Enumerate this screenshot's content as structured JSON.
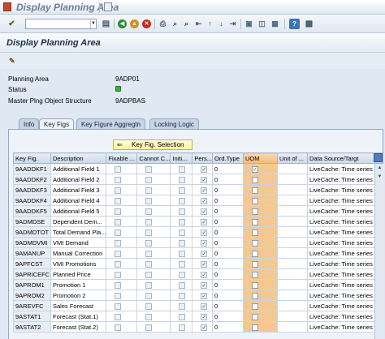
{
  "window": {
    "title": "Display Planning Area"
  },
  "toolbar": {
    "command_value": "",
    "buttons": [
      "enter",
      "save",
      "back",
      "exit",
      "cancel",
      "print",
      "find",
      "find-next",
      "first-page",
      "previous-page",
      "next-page",
      "last-page",
      "create-session",
      "generate-shortcut",
      "help",
      "layout"
    ]
  },
  "screen": {
    "title": "Display Planning Area"
  },
  "fields": {
    "planning_area_label": "Planning Area",
    "planning_area_value": "9ADP01",
    "status_label": "Status",
    "status_color": "#38b437",
    "mpos_label": "Master Plng Object Structure",
    "mpos_value": "9ADPBAS"
  },
  "tabs": [
    {
      "label": "Info",
      "active": false
    },
    {
      "label": "Key Figs",
      "active": true
    },
    {
      "label": "Key Figure Aggregtn",
      "active": false
    },
    {
      "label": "Locking Logic",
      "active": false
    }
  ],
  "keyfig_button": {
    "label": "Key Fig. Selection"
  },
  "table": {
    "columns": [
      "Key Fig.",
      "Description",
      "Fixable ...",
      "Cannot C...",
      "Initi...",
      "Pers...",
      "Ord.Type",
      "UOM",
      "Unit of ...",
      "Data Source/Targt"
    ],
    "rows": [
      {
        "key": "9AADDKF1",
        "desc": "Additional Field 1",
        "fixable": false,
        "cannot": false,
        "initi": false,
        "pers": true,
        "ord": "0",
        "uom": true,
        "unit": "",
        "source": "LiveCache: Time series"
      },
      {
        "key": "9AADDKF2",
        "desc": "Additional Field 2",
        "fixable": false,
        "cannot": false,
        "initi": false,
        "pers": true,
        "ord": "0",
        "uom": false,
        "unit": "",
        "source": "LiveCache: Time series"
      },
      {
        "key": "9AADDKF3",
        "desc": "Additional Field 3",
        "fixable": false,
        "cannot": false,
        "initi": false,
        "pers": true,
        "ord": "0",
        "uom": false,
        "unit": "",
        "source": "LiveCache: Time series"
      },
      {
        "key": "9AADDKF4",
        "desc": "Additional Field 4",
        "fixable": false,
        "cannot": false,
        "initi": false,
        "pers": true,
        "ord": "0",
        "uom": false,
        "unit": "",
        "source": "LiveCache: Time series"
      },
      {
        "key": "9AADDKF5",
        "desc": "Additional Field 5",
        "fixable": false,
        "cannot": false,
        "initi": false,
        "pers": true,
        "ord": "0",
        "uom": false,
        "unit": "",
        "source": "LiveCache: Time series"
      },
      {
        "key": "9ADMDSE",
        "desc": "Dependent Dem...",
        "fixable": false,
        "cannot": false,
        "initi": false,
        "pers": true,
        "ord": "0",
        "uom": false,
        "unit": "",
        "source": "LiveCache: Time series"
      },
      {
        "key": "9ADMDTOT",
        "desc": "Total Demand Pla...",
        "fixable": false,
        "cannot": false,
        "initi": false,
        "pers": true,
        "ord": "0",
        "uom": false,
        "unit": "",
        "source": "LiveCache: Time series"
      },
      {
        "key": "9ADMDVMI",
        "desc": "VMI Demand",
        "fixable": false,
        "cannot": false,
        "initi": false,
        "pers": true,
        "ord": "0",
        "uom": false,
        "unit": "",
        "source": "LiveCache: Time series"
      },
      {
        "key": "9AMANUP",
        "desc": "Manual Correction",
        "fixable": false,
        "cannot": false,
        "initi": false,
        "pers": true,
        "ord": "0",
        "uom": false,
        "unit": "",
        "source": "LiveCache: Time series"
      },
      {
        "key": "9APFCST",
        "desc": "VMI Promotions",
        "fixable": false,
        "cannot": false,
        "initi": false,
        "pers": true,
        "ord": "0",
        "uom": false,
        "unit": "",
        "source": "LiveCache: Time series"
      },
      {
        "key": "9APRICEFC",
        "desc": "Planned Price",
        "fixable": false,
        "cannot": false,
        "initi": false,
        "pers": true,
        "ord": "0",
        "uom": false,
        "unit": "",
        "source": "LiveCache: Time series"
      },
      {
        "key": "9APROM1",
        "desc": "Promotion 1",
        "fixable": false,
        "cannot": false,
        "initi": false,
        "pers": true,
        "ord": "0",
        "uom": false,
        "unit": "",
        "source": "LiveCache: Time series"
      },
      {
        "key": "9APROM2",
        "desc": "Promotion 2",
        "fixable": false,
        "cannot": false,
        "initi": false,
        "pers": true,
        "ord": "0",
        "uom": false,
        "unit": "",
        "source": "LiveCache: Time series"
      },
      {
        "key": "9AREVFC",
        "desc": "Sales Forecast",
        "fixable": false,
        "cannot": false,
        "initi": false,
        "pers": true,
        "ord": "0",
        "uom": false,
        "unit": "",
        "source": "LiveCache: Time series"
      },
      {
        "key": "9ASTAT1",
        "desc": "Forecast (Stat.1)",
        "fixable": false,
        "cannot": false,
        "initi": false,
        "pers": true,
        "ord": "0",
        "uom": false,
        "unit": "",
        "source": "LiveCache: Time series"
      },
      {
        "key": "9ASTAT2",
        "desc": "Forecast (Stat.2)",
        "fixable": false,
        "cannot": false,
        "initi": false,
        "pers": true,
        "ord": "0",
        "uom": false,
        "unit": "",
        "source": "LiveCache: Time series"
      }
    ]
  },
  "colors": {
    "uom_column": "#f4c892",
    "accent": "#4d7fbf"
  }
}
